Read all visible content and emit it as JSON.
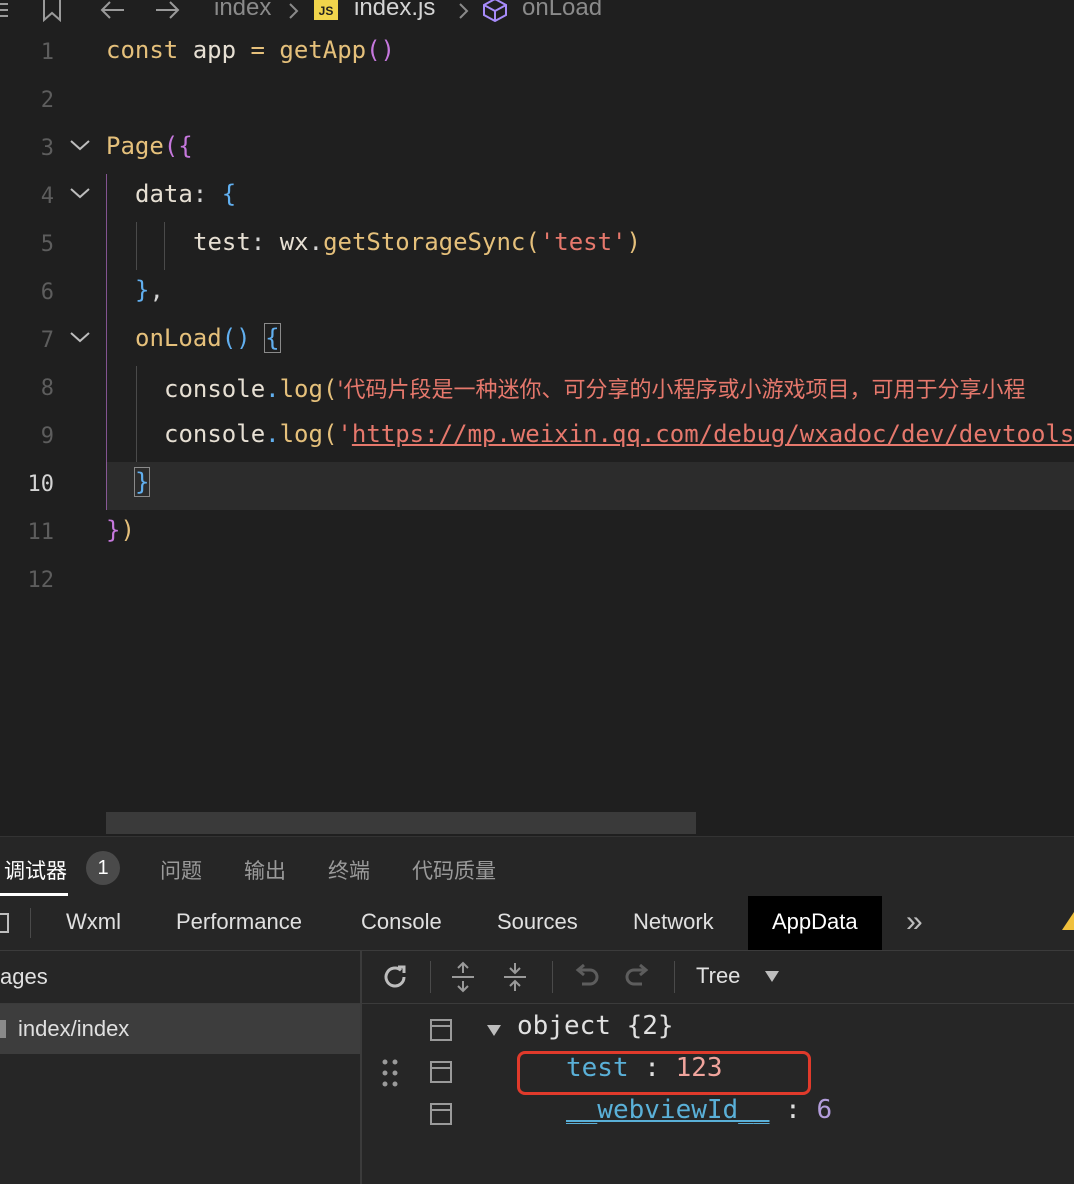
{
  "breadcrumb": {
    "folder": "index",
    "file_badge": "JS",
    "file": "index.js",
    "symbol": "onLoad"
  },
  "editor": {
    "lines": [
      {
        "num": "1"
      },
      {
        "num": "2"
      },
      {
        "num": "3"
      },
      {
        "num": "4"
      },
      {
        "num": "5"
      },
      {
        "num": "6"
      },
      {
        "num": "7"
      },
      {
        "num": "8"
      },
      {
        "num": "9"
      },
      {
        "num": "10"
      },
      {
        "num": "11"
      },
      {
        "num": "12"
      }
    ],
    "code": {
      "l1_const": "const",
      "l1_app": " app ",
      "l1_eq": "=",
      "l1_fn": " getApp",
      "l1_paren": "()",
      "l3_page": "Page",
      "l3_paren": "(",
      "l3_brace": "{",
      "l4_data": "data",
      "l4_colon": ": ",
      "l4_brace": "{",
      "l5_test": "test",
      "l5_colon": ": ",
      "l5_wx": "wx",
      "l5_dot": ".",
      "l5_fn": "getStorageSync",
      "l5_open": "(",
      "l5_str": "'test'",
      "l5_close": ")",
      "l6_brace": "}",
      "l6_comma": ",",
      "l7_fn": "onLoad",
      "l7_parens": "()",
      "l7_brace": "{",
      "l8_console": "console",
      "l8_dot": ".",
      "l8_log": "log",
      "l8_open": "(",
      "l8_str": "'代码片段是一种迷你、可分享的小程序或小游戏项目，可用于分享小程",
      "l9_console": "console",
      "l9_dot": ".",
      "l9_log": "log",
      "l9_open": "(",
      "l9_quote": "'",
      "l9_url": "https://mp.weixin.qq.com/debug/wxadoc/dev/devtools",
      "l10_brace": "}",
      "l11_brace": "}",
      "l11_paren": ")"
    }
  },
  "panel_tabs": {
    "debugger": "调试器",
    "debugger_count": "1",
    "problems": "问题",
    "output": "输出",
    "terminal": "终端",
    "code_quality": "代码质量"
  },
  "devtools_tabs": {
    "wxml": "Wxml",
    "performance": "Performance",
    "console": "Console",
    "sources": "Sources",
    "network": "Network",
    "appdata": "AppData",
    "more": "»"
  },
  "pages_pane": {
    "header": "ages",
    "row": "index/index"
  },
  "data_toolbar": {
    "view_mode": "Tree"
  },
  "tree": {
    "root_label": "object",
    "root_count": "{2}",
    "items": [
      {
        "key": "test",
        "sep": " : ",
        "value": "123"
      },
      {
        "key": "__webviewId__",
        "sep": " : ",
        "value": "6"
      }
    ]
  }
}
